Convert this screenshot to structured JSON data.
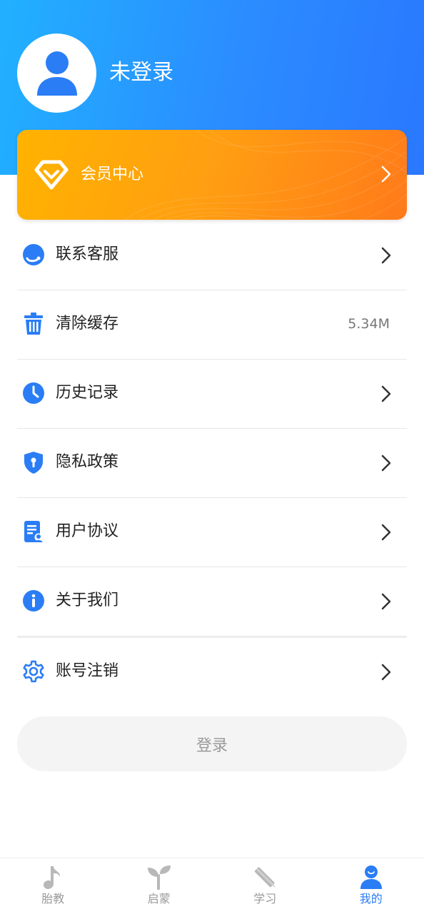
{
  "profile": {
    "username": "未登录"
  },
  "vip": {
    "label": "会员中心"
  },
  "menu": {
    "items": [
      {
        "label": "联系客服",
        "icon": "headset-icon"
      },
      {
        "label": "清除缓存",
        "icon": "trash-icon",
        "value": "5.34M"
      },
      {
        "label": "历史记录",
        "icon": "clock-icon"
      },
      {
        "label": "隐私政策",
        "icon": "shield-icon"
      },
      {
        "label": "用户协议",
        "icon": "document-icon"
      },
      {
        "label": "关于我们",
        "icon": "info-icon"
      },
      {
        "label": "账号注销",
        "icon": "gear-icon"
      }
    ]
  },
  "login_button": {
    "label": "登录"
  },
  "tabbar": {
    "tabs": [
      {
        "label": "胎教",
        "icon": "music-note-icon",
        "active": false
      },
      {
        "label": "启蒙",
        "icon": "sprout-icon",
        "active": false
      },
      {
        "label": "学习",
        "icon": "pencil-ruler-icon",
        "active": false
      },
      {
        "label": "我的",
        "icon": "user-icon",
        "active": true
      }
    ]
  },
  "colors": {
    "accent": "#2a7df5",
    "header_gradient_start": "#21b1ff",
    "header_gradient_end": "#2a78ff",
    "vip_gradient_start": "#ffb300",
    "vip_gradient_end": "#ff7a1a",
    "inactive": "#9a9a9a"
  }
}
